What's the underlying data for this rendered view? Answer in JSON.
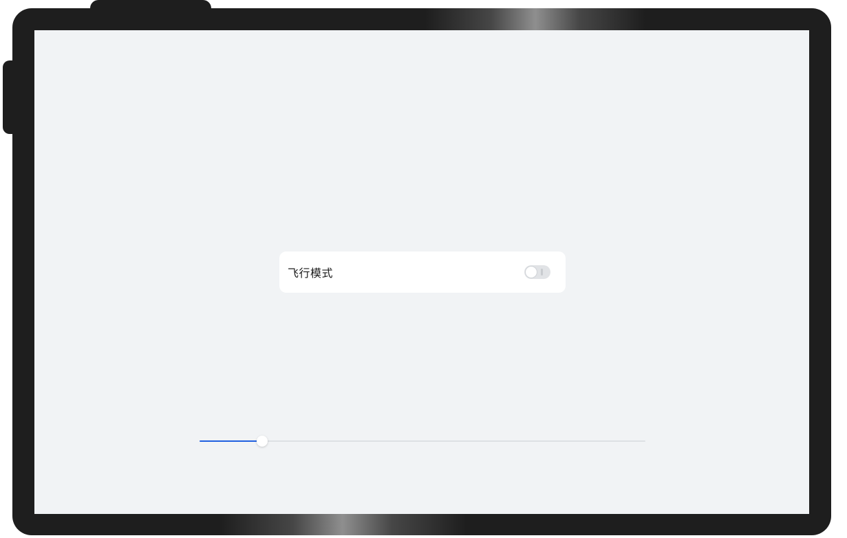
{
  "settings": {
    "airplane_mode": {
      "label": "飞行模式",
      "enabled": false
    }
  },
  "slider": {
    "value_fraction": 0.14
  },
  "colors": {
    "screen_background": "#f1f3f5",
    "card_background": "#ffffff",
    "slider_active": "#1f5fe0",
    "slider_track": "#dde0e4",
    "device_frame": "#1e1e1e"
  },
  "icons": {
    "toggle_state_icon": "toggle-off-icon"
  }
}
